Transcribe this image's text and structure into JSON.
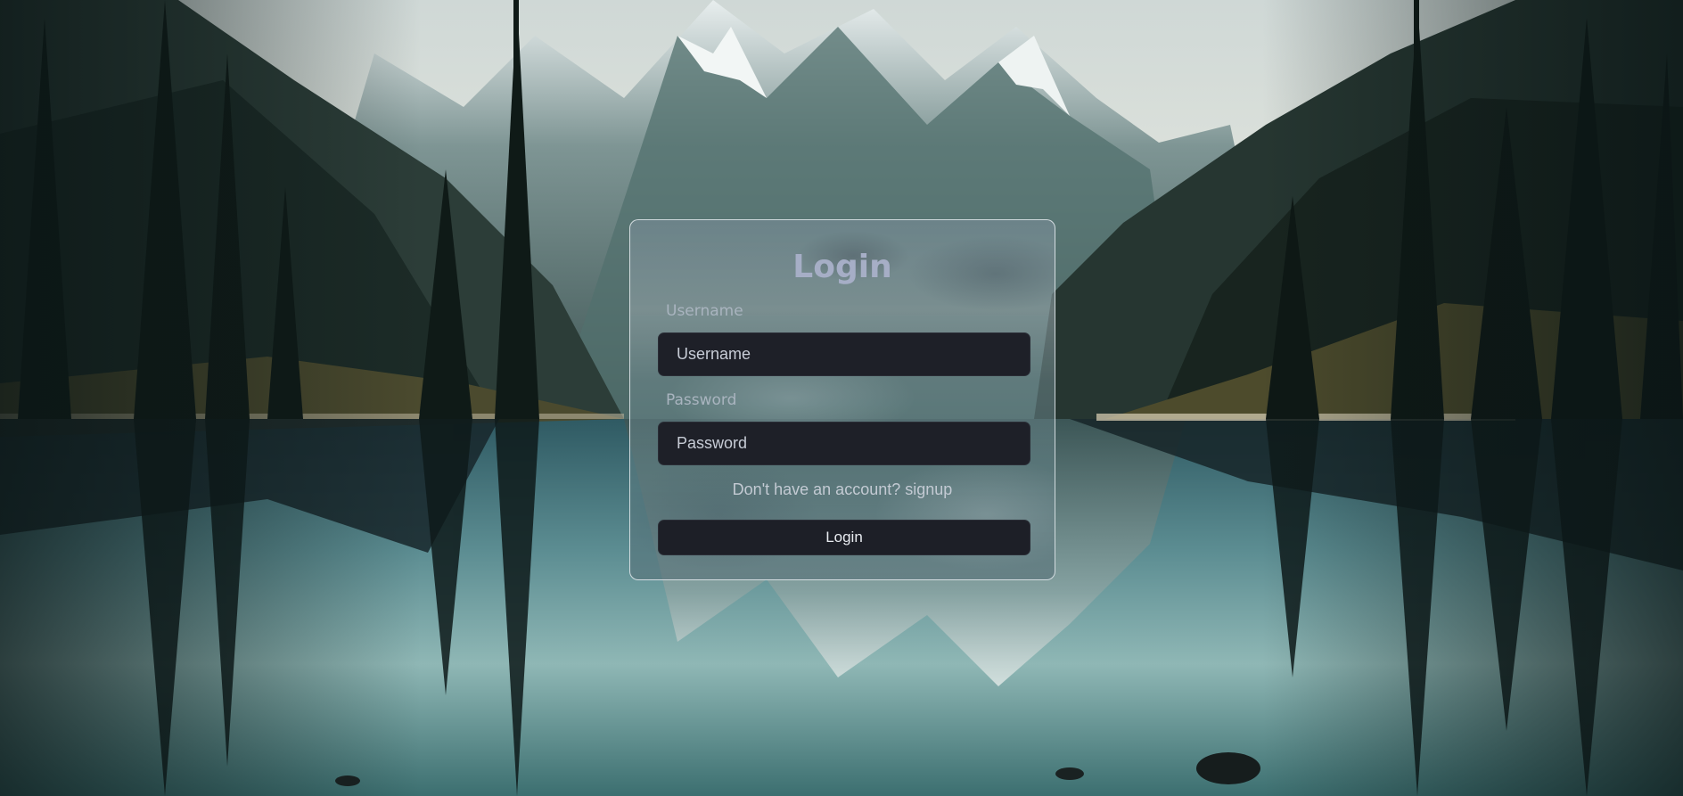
{
  "login_form": {
    "title": "Login",
    "username_label": "Username",
    "username_placeholder": "Username",
    "username_value": "",
    "password_label": "Password",
    "password_placeholder": "Password",
    "password_value": "",
    "signup_prompt": "Don't have an account?",
    "signup_link": "signup",
    "submit_label": "Login"
  },
  "colors": {
    "title": "#a6aec6",
    "input_bg": "#1e2028",
    "button_bg": "#1d1f27",
    "card_border": "#e6ecf0"
  }
}
